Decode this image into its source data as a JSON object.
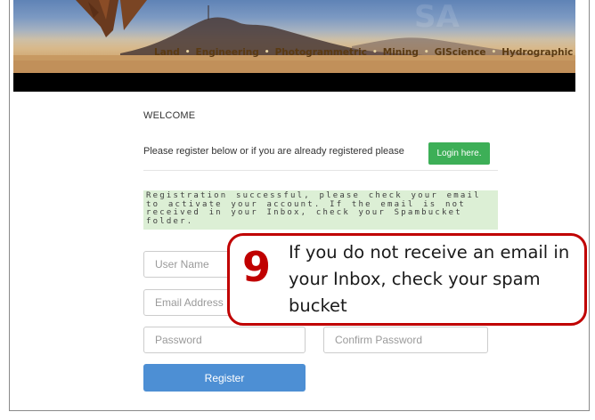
{
  "header": {
    "nav_items": [
      "Land",
      "Engineering",
      "Photogrammetric",
      "Mining",
      "GIScience",
      "Hydrographic"
    ],
    "separator": "•"
  },
  "main": {
    "welcome": "WELCOME",
    "register_prompt": "Please register below or if you are already registered please",
    "login_button": "Login here.",
    "success_message": "Registration successful, please check your email to activate your account. If the email is not received in your Inbox, check your Spambucket folder.",
    "form": {
      "username_placeholder": "User Name",
      "email_placeholder": "Email Address",
      "password_placeholder": "Password",
      "confirm_password_placeholder": "Confirm Password",
      "register_button": "Register"
    }
  },
  "callout": {
    "number": "9",
    "text": "If you do not receive an email in your Inbox, check your spam bucket"
  },
  "colors": {
    "login_green": "#3daf57",
    "register_blue": "#4d8fd4",
    "success_bg": "#dcefd5",
    "callout_red": "#c00000"
  }
}
